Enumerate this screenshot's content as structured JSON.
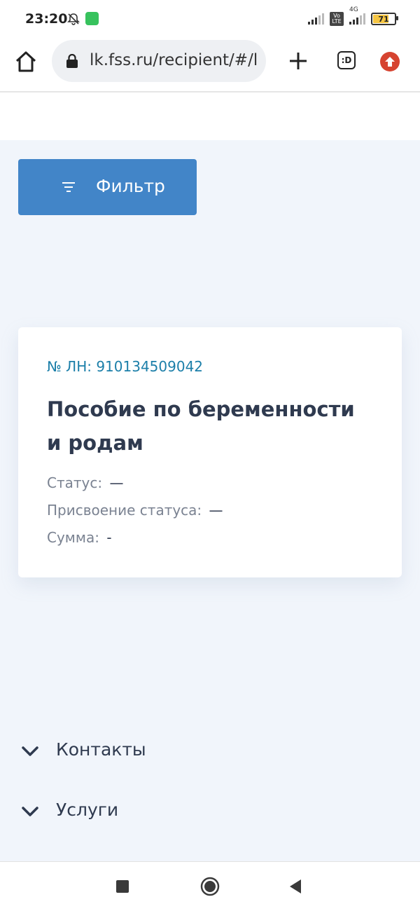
{
  "status_bar": {
    "time": "23:20",
    "battery": "71",
    "network_label": "4G",
    "volte_label": "Vo\nLTE"
  },
  "browser": {
    "url": "lk.fss.ru/recipient/#/l",
    "tabs_label": ":D"
  },
  "filter": {
    "label": "Фильтр"
  },
  "card": {
    "ln": "№ ЛН: 910134509042",
    "title": "Пособие по беременности и родам",
    "status_label": "Статус:",
    "status_value": "—",
    "assign_label": "Присвоение статуса:",
    "assign_value": "—",
    "sum_label": "Сумма:",
    "sum_value": "-"
  },
  "footer": {
    "contacts": "Контакты",
    "services": "Услуги"
  },
  "colors": {
    "accent": "#4285c8",
    "ln_link": "#1c7fa9",
    "background": "#f1f5fb"
  }
}
